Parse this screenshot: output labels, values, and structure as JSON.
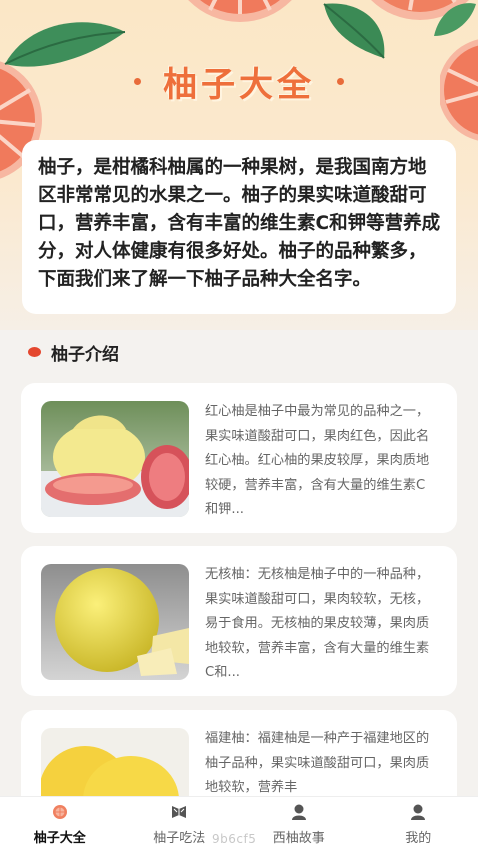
{
  "header": {
    "title": "柚子大全"
  },
  "intro": {
    "text": "柚子，是柑橘科柚属的一种果树，是我国南方地区非常常见的水果之一。柚子的果实味道酸甜可口，营养丰富，含有丰富的维生素C和钾等营养成分，对人体健康有很多好处。柚子的品种繁多，下面我们来了解一下柚子品种大全名字。"
  },
  "section": {
    "title": "柚子介绍"
  },
  "items": [
    {
      "text": "红心柚是柚子中最为常见的品种之一，果实味道酸甜可口，果肉红色，因此名红心柚。红心柚的果皮较厚，果肉质地较硬，营养丰富，含有大量的维生素C和钾...",
      "image": "red-pomelo-photo"
    },
    {
      "text": "无核柚：无核柚是柚子中的一种品种，果实味道酸甜可口，果肉较软，无核，易于食用。无核柚的果皮较薄，果肉质地较软，营养丰富，含有大量的维生素C和...",
      "image": "seedless-pomelo-photo"
    },
    {
      "text": "福建柚：福建柚是一种产于福建地区的柚子品种，果实味道酸甜可口，果肉质地较软，营养丰",
      "image": "fujian-pomelo-photo"
    }
  ],
  "tabbar": {
    "tabs": [
      {
        "label": "柚子大全",
        "icon": "pomelo-icon",
        "active": true
      },
      {
        "label": "柚子吃法",
        "icon": "book-icon",
        "active": false
      },
      {
        "label": "西柚故事",
        "icon": "person-icon",
        "active": false
      },
      {
        "label": "我的",
        "icon": "profile-icon",
        "active": false
      }
    ]
  },
  "watermark": "9b6cf5",
  "colors": {
    "accent": "#ee6f3b",
    "dot": "#e4472e",
    "background": "#f4f2ef"
  }
}
